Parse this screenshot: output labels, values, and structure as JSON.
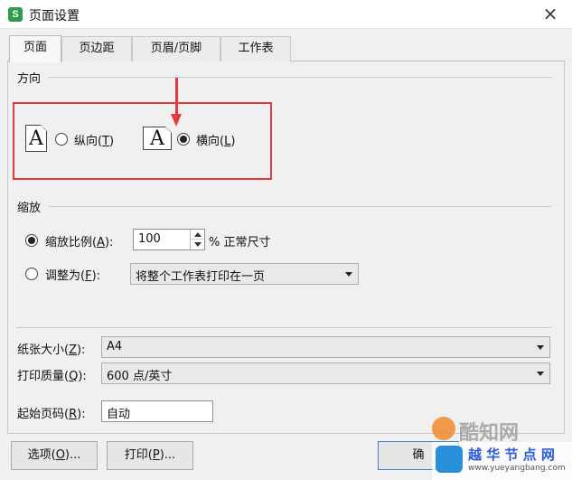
{
  "window": {
    "title": "页面设置",
    "close_glyph": "×",
    "app_icon": "S"
  },
  "tabs": [
    {
      "label": "页面"
    },
    {
      "label": "页边距"
    },
    {
      "label": "页眉/页脚"
    },
    {
      "label": "工作表"
    }
  ],
  "orientation": {
    "label": "方向",
    "portrait": {
      "text": "纵向(",
      "key": "T",
      "end": ")",
      "checked": false,
      "glyph": "A"
    },
    "landscape": {
      "text": "横向(",
      "key": "L",
      "end": ")",
      "checked": true,
      "glyph": "A"
    }
  },
  "scaling": {
    "label": "缩放",
    "scale": {
      "text": "缩放比例(",
      "key": "A",
      "end": "):",
      "value": "100",
      "suffix": "% 正常尺寸",
      "checked": true
    },
    "fit": {
      "text": "调整为(",
      "key": "F",
      "end": "):",
      "value": "将整个工作表打印在一页",
      "checked": false
    }
  },
  "paper_size": {
    "text": "纸张大小(",
    "key": "Z",
    "end": "):",
    "value": "A4"
  },
  "print_quality": {
    "text": "打印质量(",
    "key": "Q",
    "end": "):",
    "value": "600 点/英寸"
  },
  "first_page": {
    "text": "起始页码(",
    "key": "R",
    "end": "):",
    "value": "自动"
  },
  "buttons": {
    "options": {
      "text": "选项(",
      "key": "O",
      "end": ")..."
    },
    "print": {
      "text": "打印(",
      "key": "P",
      "end": ")..."
    },
    "ok_partial": "确"
  },
  "colors": {
    "highlight": "#e33b3b",
    "accent_icon": "#2e9c4a"
  },
  "watermark": {
    "top_text": "酷知网",
    "bottom_text": "越 华 节 点 网",
    "url": "www.yueyangbang.com"
  }
}
